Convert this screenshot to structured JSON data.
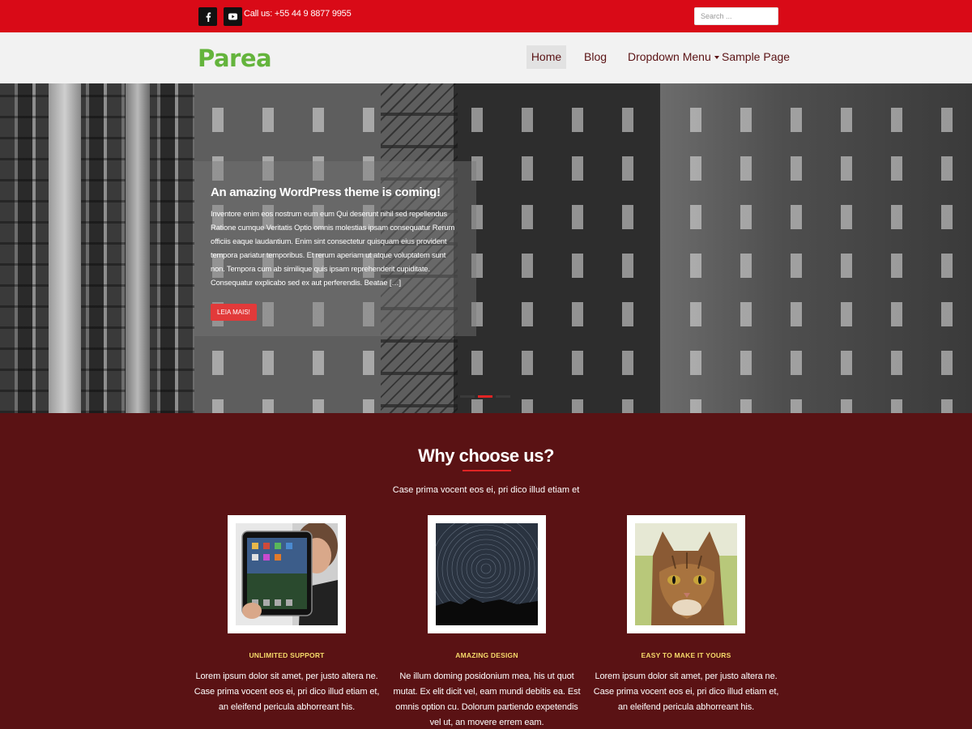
{
  "topbar": {
    "social": [
      {
        "name": "facebook-icon"
      },
      {
        "name": "youtube-icon"
      }
    ],
    "call_text": "Call us: +55 44 9 8877 9955",
    "search_placeholder": "Search ...",
    "colors": {
      "bar": "#d90a17",
      "social_bg": "#111111"
    }
  },
  "header": {
    "logo": "Parea",
    "logo_color": "#64b43c",
    "nav": [
      {
        "label": "Home",
        "active": true
      },
      {
        "label": "Blog",
        "active": false
      },
      {
        "label": "Dropdown Menu",
        "active": false,
        "has_caret": true
      },
      {
        "label": "Sample Page",
        "active": false
      }
    ]
  },
  "hero": {
    "title": "An amazing WordPress theme is coming!",
    "text": "Inventore enim eos nostrum eum eum Qui deserunt nihil sed repellendus Ratione cumque Veritatis Optio omnis molestias ipsam consequatur Rerum officiis eaque laudantium. Enim sint consectetur quisquam eius provident tempora pariatur temporibus. Et rerum aperiam ut atque voluptatem sunt non. Tempora cum ab similique quis ipsam reprehenderit cupiditate. Consequatur explicabo sed ex aut perferendis. Beatae […]",
    "button": "LEIA MAIS!",
    "slides": 3,
    "active_slide": 2
  },
  "features": {
    "title": "Why choose us?",
    "subtitle": "Case prima vocent eos ei, pri dico illud etiam et",
    "items": [
      {
        "image": "tablet-photo",
        "title": "UNLIMITED SUPPORT",
        "text": "Lorem ipsum dolor sit amet, per justo altera ne. Case prima vocent eos ei, pri dico illud etiam et, an eleifend pericula abhorreant his."
      },
      {
        "image": "star-trails-photo",
        "title": "AMAZING DESIGN",
        "text": "Ne illum doming posidonium mea, his ut quot mutat. Ex elit dicit vel, eam mundi debitis ea. Est omnis option cu. Dolorum partiendo expetendis vel ut, an movere errem eam."
      },
      {
        "image": "cat-photo",
        "title": "EASY TO MAKE IT YOURS",
        "text": "Lorem ipsum dolor sit amet, per justo altera ne. Case prima vocent eos ei, pri dico illud etiam et, an eleifend pericula abhorreant his."
      }
    ],
    "colors": {
      "section_bg": "#5a1214",
      "accent": "#e02424",
      "feature_title": "#f6d96a"
    }
  }
}
